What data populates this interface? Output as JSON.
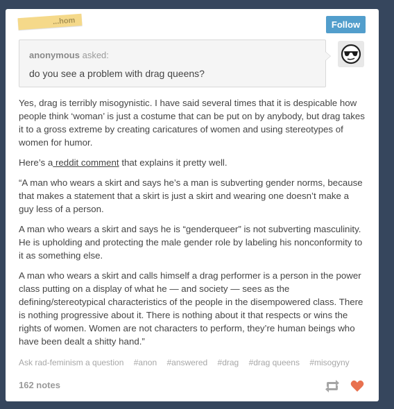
{
  "header": {
    "username_partial": "...hom",
    "follow_label": "Follow"
  },
  "ask": {
    "asker": "anonymous",
    "asked_label": "asked:",
    "question": "do you see a problem with drag queens?",
    "avatar_icon": "sunglasses-face-icon"
  },
  "answer": {
    "p1": "Yes, drag is terribly misogynistic. I have said several times that it is despicable how people think ‘woman’ is just a costume that can be put on by anybody, but drag takes it to a gross extreme by creating caricatures of women and using stereotypes of women for humor.",
    "p2_before": "Here’s a",
    "p2_link": " reddit comment",
    "p2_after": " that explains it pretty well.",
    "p3": "“A man who wears a skirt and says he’s a man is subverting gender norms, because that makes a statement that a skirt is just a skirt and wearing one doesn’t make a guy less of a person.",
    "p4": "A man who wears a skirt and says he is “genderqueer” is not subverting masculinity. He is upholding and protecting the male gender role by labeling his nonconformity to it as something else.",
    "p5": "A man who wears a skirt and calls himself a drag performer is a person in the power class putting on a display of what he — and society — sees as the defining/stereotypical characteristics of the people in the disempowered class. There is nothing progressive about it. There is nothing about it that respects or wins the rights of women. Women are not characters to perform, they’re human beings who have been dealt a shitty hand.”"
  },
  "footer": {
    "ask_link": "Ask rad-feminism a question",
    "tags": [
      "#anon",
      "#answered",
      "#drag",
      "#drag queens",
      "#misogyny"
    ],
    "notes": "162 notes",
    "reblog_icon": "reblog-icon",
    "like_icon": "heart-icon"
  },
  "colors": {
    "background": "#36465d",
    "follow_button": "#529ecc",
    "like_heart": "#e8714f",
    "tape": "#f5d98a"
  }
}
